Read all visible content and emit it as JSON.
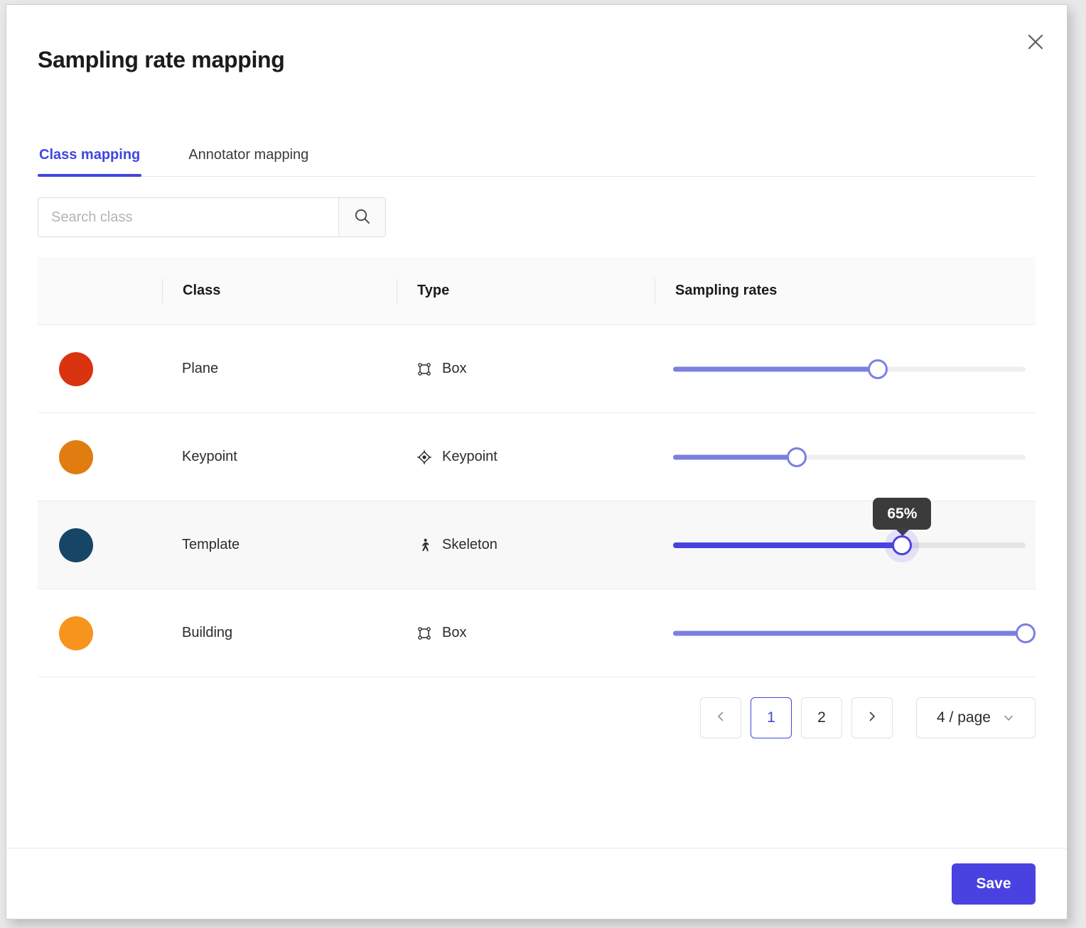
{
  "dialog": {
    "title": "Sampling rate mapping",
    "close_icon": "close-icon"
  },
  "tabs": [
    {
      "label": "Class mapping",
      "active": true
    },
    {
      "label": "Annotator mapping",
      "active": false
    }
  ],
  "search": {
    "placeholder": "Search class",
    "value": "",
    "icon": "search-icon"
  },
  "table": {
    "columns": [
      "",
      "Class",
      "Type",
      "Sampling rates"
    ],
    "rows": [
      {
        "color": "#d9330f",
        "class": "Plane",
        "type": "Box",
        "type_icon": "box-icon",
        "rate": 58,
        "highlighted": false,
        "active": false
      },
      {
        "color": "#e07c10",
        "class": "Keypoint",
        "type": "Keypoint",
        "type_icon": "keypoint-icon",
        "rate": 35,
        "highlighted": false,
        "active": false
      },
      {
        "color": "#174566",
        "class": "Template",
        "type": "Skeleton",
        "type_icon": "skeleton-icon",
        "rate": 65,
        "rate_label": "65%",
        "highlighted": true,
        "active": true
      },
      {
        "color": "#f7941e",
        "class": "Building",
        "type": "Box",
        "type_icon": "box-icon",
        "rate": 100,
        "highlighted": false,
        "active": false
      }
    ]
  },
  "pagination": {
    "prev_label": "‹",
    "next_label": "›",
    "pages": [
      "1",
      "2"
    ],
    "current_page": "1",
    "page_size_label": "4 / page",
    "chevron_icon": "chevron-down-icon"
  },
  "footer": {
    "save_label": "Save"
  },
  "colors": {
    "accent": "#3f46e0",
    "slider_fill": "#7b7fe0",
    "slider_active": "#4a42e0",
    "tooltip_bg": "#3b3b3b"
  }
}
